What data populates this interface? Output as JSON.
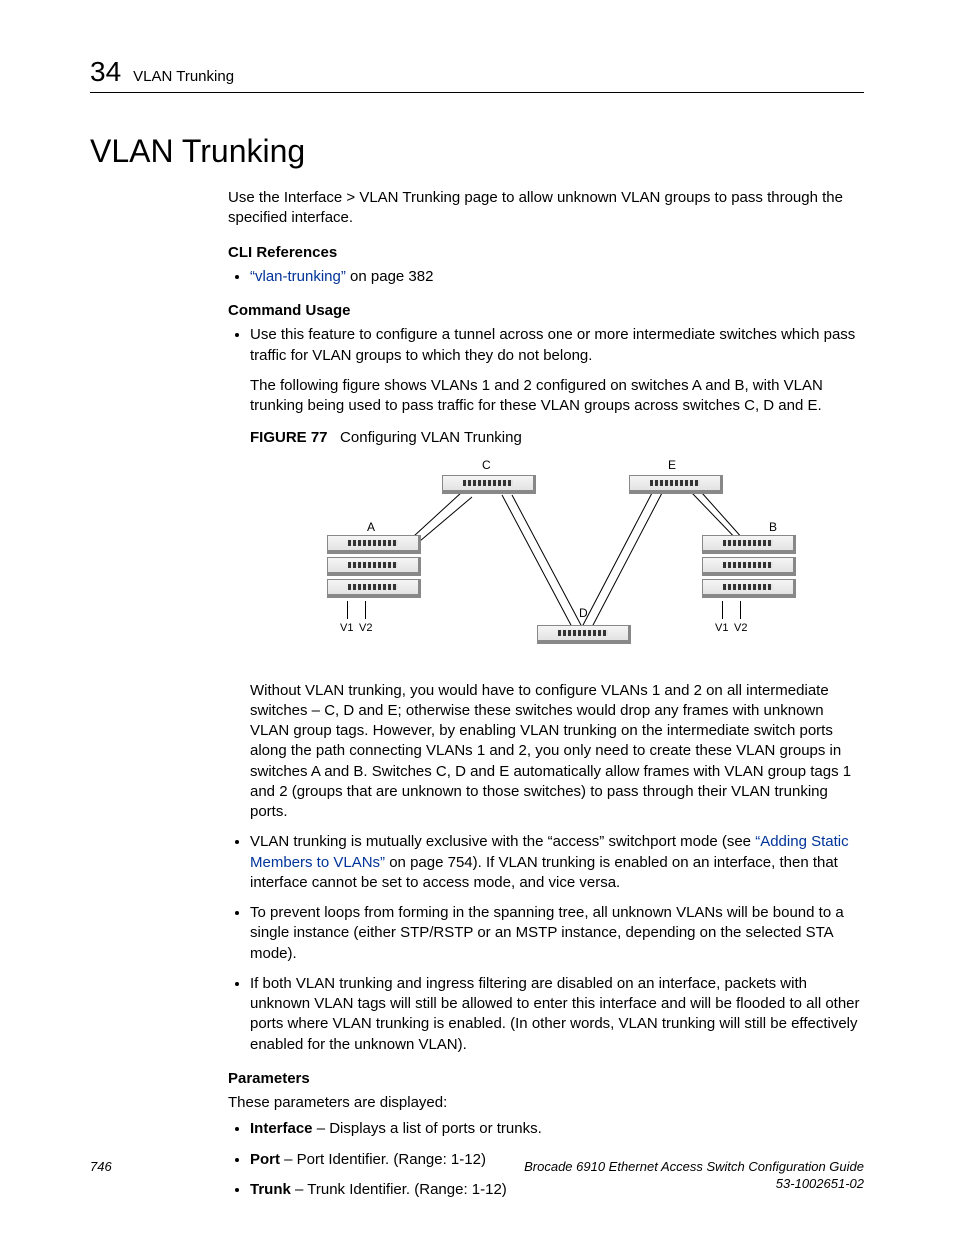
{
  "header": {
    "chapter_number": "34",
    "running_head": "VLAN Trunking"
  },
  "title": "VLAN Trunking",
  "intro": "Use the Interface > VLAN Trunking page to allow unknown VLAN groups to pass through the specified interface.",
  "cli_refs": {
    "heading": "CLI References",
    "items": [
      {
        "link_text": "“vlan-trunking”",
        "rest": " on page 382"
      }
    ]
  },
  "cmd_usage": {
    "heading": "Command Usage",
    "bullet1": "Use this feature to configure a tunnel across one or more intermediate switches which pass traffic for VLAN groups to which they do not belong.",
    "bullet1_p2": "The following figure shows VLANs 1 and 2 configured on switches A and B, with VLAN trunking being used to pass traffic for these VLAN groups across switches C, D and E.",
    "fig_label": "FIGURE 77",
    "fig_title": "Configuring VLAN Trunking",
    "after_fig": "Without VLAN trunking, you would have to configure VLANs 1 and 2 on all intermediate switches – C, D and E; otherwise these switches would drop any frames with unknown VLAN group tags. However, by enabling VLAN trunking on the intermediate switch ports along the path connecting VLANs 1 and 2, you only need to create these VLAN groups in switches A and B. Switches C, D and E automatically allow frames with VLAN group tags 1 and 2 (groups that are unknown to those switches) to pass through their VLAN trunking ports.",
    "bullet2_pre": "VLAN trunking is mutually exclusive with the “access” switchport mode (see ",
    "bullet2_link": "“Adding Static Members to VLANs”",
    "bullet2_post": " on page 754). If VLAN trunking is enabled on an interface, then that interface cannot be set to access mode, and vice versa.",
    "bullet3": "To prevent loops from forming in the spanning tree, all unknown VLANs will be bound to a single instance (either STP/RSTP or an MSTP instance, depending on the selected STA mode).",
    "bullet4": "If both VLAN trunking and ingress filtering are disabled on an interface, packets with unknown VLAN tags will still be allowed to enter this interface and will be flooded to all other ports where VLAN trunking is enabled. (In other words, VLAN trunking will still be effectively enabled for the unknown VLAN)."
  },
  "params": {
    "heading": "Parameters",
    "intro": "These parameters are displayed:",
    "items": [
      {
        "term": "Interface",
        "desc": " – Displays a list of ports or trunks."
      },
      {
        "term": "Port",
        "desc": " – Port Identifier. (Range: 1-12)"
      },
      {
        "term": "Trunk",
        "desc": " – Trunk Identifier. (Range: 1-12)"
      }
    ]
  },
  "diagram": {
    "labels": {
      "A": "A",
      "B": "B",
      "C": "C",
      "D": "D",
      "E": "E",
      "V1": "V1",
      "V2": "V2"
    }
  },
  "footer": {
    "page": "746",
    "doc_title": "Brocade 6910 Ethernet Access Switch Configuration Guide",
    "doc_num": "53-1002651-02"
  }
}
